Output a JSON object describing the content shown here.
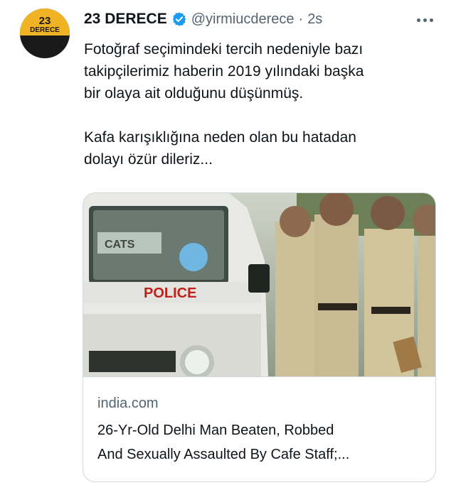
{
  "author": {
    "avatar_number": "23",
    "avatar_word": "DERECE",
    "display_name": "23 DERECE",
    "handle": "@yirmiucderece",
    "separator": "·",
    "timestamp": "2s"
  },
  "tweet": {
    "paragraph1_line1": "Fotoğraf seçimindeki tercih nedeniyle bazı",
    "paragraph1_line2": "takipçilerimiz haberin 2019 yılındaki başka",
    "paragraph1_line3": "bir olaya ait olduğunu düşünmüş.",
    "paragraph2_line1": "Kafa karışıklığına neden olan bu hatadan",
    "paragraph2_line2": "dolayı özür dileriz..."
  },
  "link_card": {
    "image_text": "POLICE",
    "domain": "india.com",
    "headline_line1": "26-Yr-Old Delhi Man Beaten, Robbed",
    "headline_line2": "And Sexually Assaulted By Cafe Staff;..."
  },
  "icons": {
    "verified": "verified-badge-icon",
    "more": "more-options-icon"
  },
  "colors": {
    "verified_blue": "#1d9bf0",
    "secondary_text": "#536471",
    "avatar_gold": "#f0b323"
  }
}
